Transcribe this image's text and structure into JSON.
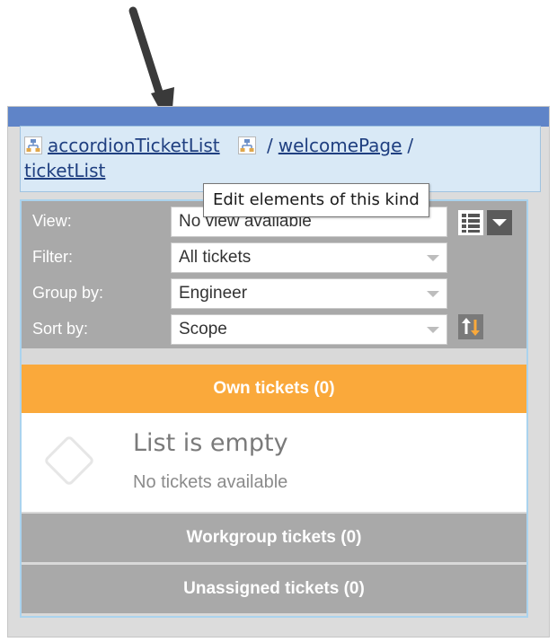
{
  "breadcrumb": {
    "component": "accordionTicketList",
    "separator": "/",
    "path": [
      "welcomePage",
      "ticketList"
    ]
  },
  "tooltip": "Edit elements of this kind",
  "filters": {
    "view": {
      "label": "View:",
      "value": "No view available"
    },
    "filter": {
      "label": "Filter:",
      "value": "All tickets"
    },
    "group_by": {
      "label": "Group by:",
      "value": "Engineer"
    },
    "sort_by": {
      "label": "Sort by:",
      "value": "Scope"
    }
  },
  "icons": {
    "hierarchy": "hierarchy-icon",
    "grid": "grid-view-icon",
    "dropdown": "chevron-down-icon",
    "sort": "sort-order-icon",
    "empty": "empty-list-icon",
    "arrow": "annotation-arrow-icon"
  },
  "sections": {
    "own": {
      "label": "Own tickets (0)"
    },
    "workgroup": {
      "label": "Workgroup tickets (0)"
    },
    "unassigned": {
      "label": "Unassigned tickets (0)"
    }
  },
  "empty_state": {
    "title": "List is empty",
    "subtitle": "No tickets available"
  },
  "colors": {
    "accent_orange": "#faa93b",
    "header_blue": "#5f84c8",
    "breadcrumb_bg": "#d9e9f6",
    "link_blue": "#1f3f80",
    "filter_bg": "#a9a9a9",
    "sort_arrow_up": "#ffffff",
    "sort_arrow_down": "#faa93b"
  }
}
